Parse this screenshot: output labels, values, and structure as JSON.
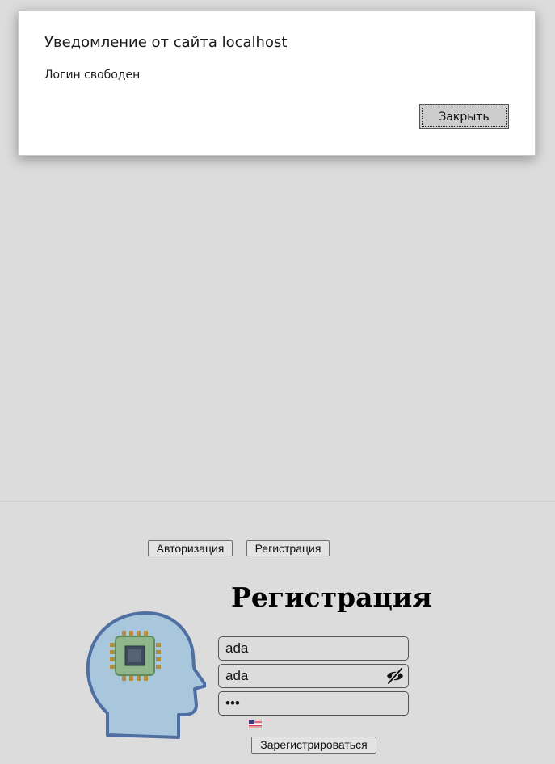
{
  "dialog": {
    "title": "Уведомление от сайта localhost",
    "message": "Логин свободен",
    "close_label": "Закрыть"
  },
  "tabs": {
    "login_label": "Авторизация",
    "register_label": "Регистрация"
  },
  "form": {
    "title": "Регистрация",
    "login_value": "ada",
    "password_value": "ada",
    "confirm_value": "•••",
    "submit_label": "Зарегистрироваться"
  },
  "icons": {
    "logo": "head-with-chip-icon",
    "password_toggle": "eye-slash-icon",
    "language": "us-flag-icon"
  },
  "colors": {
    "page_background": "#dcdcdc",
    "logo_head": "#a8c6dc",
    "logo_outline": "#4f6fa3",
    "chip_green": "#8fb58a",
    "chip_pins": "#b38b3c"
  }
}
